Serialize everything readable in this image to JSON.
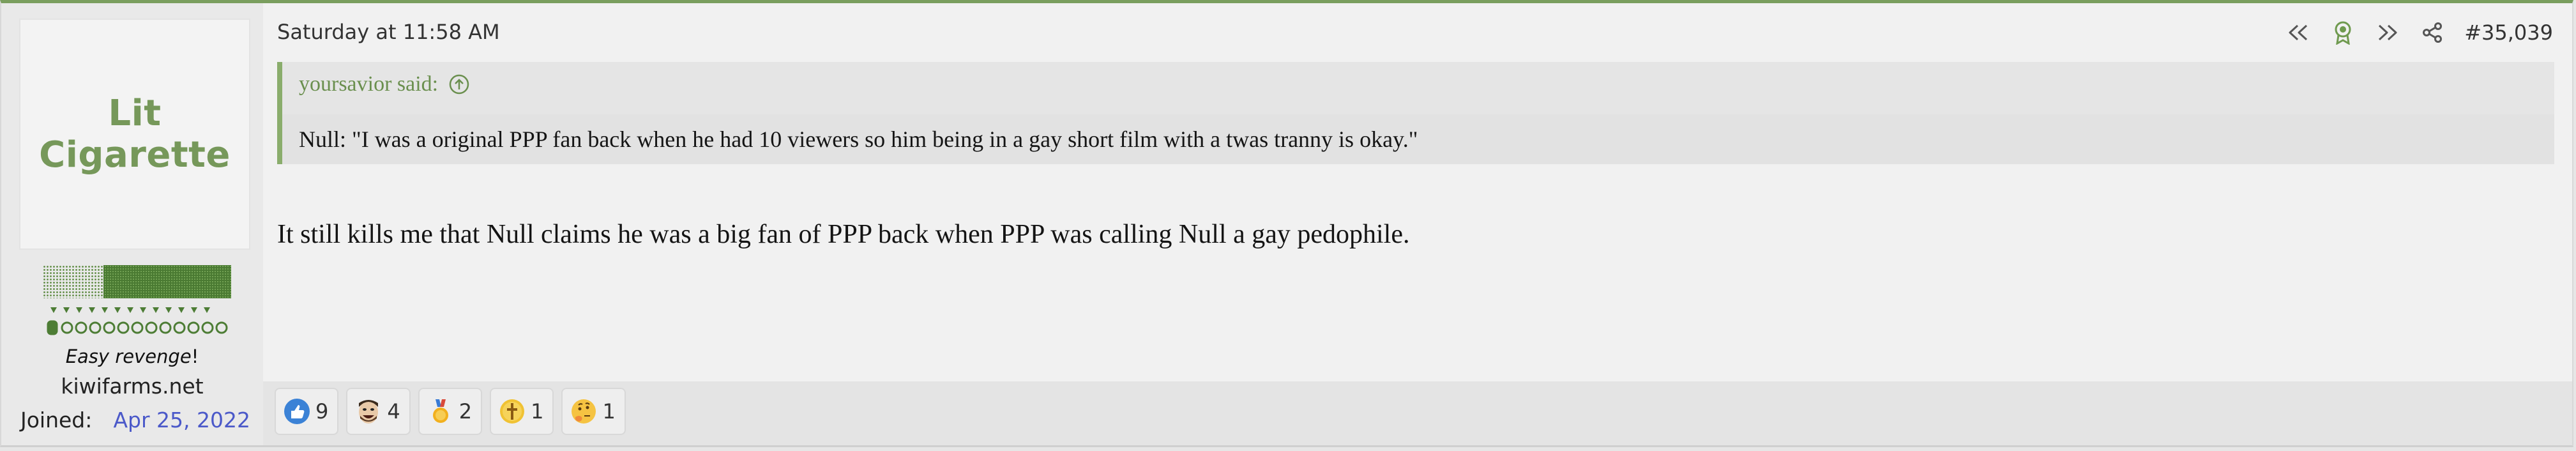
{
  "user": {
    "avatar_text": "Lit Cigarette",
    "title_prefix": "Easy revenge",
    "title_suffix": "!",
    "site": "kiwifarms.net",
    "joined_label": "Joined:",
    "joined_value": "Apr 25, 2022"
  },
  "post": {
    "date": "Saturday at 11:58 AM",
    "number": "#35,039",
    "quote": {
      "author": "yoursavior said:",
      "text": "Null: \"I was a original PPP fan back when he had 10 viewers so him being in a gay short film with a twas tranny is okay.\""
    },
    "body": "It still kills me that Null claims he was a big fan of PPP back when PPP was calling Null a gay pedophile."
  },
  "actions": [
    {
      "icon": "first-unread-icon"
    },
    {
      "icon": "award-ribbon-icon"
    },
    {
      "icon": "fast-forward-icon"
    },
    {
      "icon": "share-icon"
    }
  ],
  "reactions": [
    {
      "icon": "thumbs-up-icon",
      "count": "9"
    },
    {
      "icon": "laughing-face-icon",
      "count": "4"
    },
    {
      "icon": "medal-icon",
      "count": "2"
    },
    {
      "icon": "cross-coin-icon",
      "count": "1"
    },
    {
      "icon": "thinking-face-icon",
      "count": "1"
    }
  ],
  "colors": {
    "accent": "#7a9e5e",
    "link": "#4b59c9",
    "quote_author": "#6a8f4e"
  }
}
